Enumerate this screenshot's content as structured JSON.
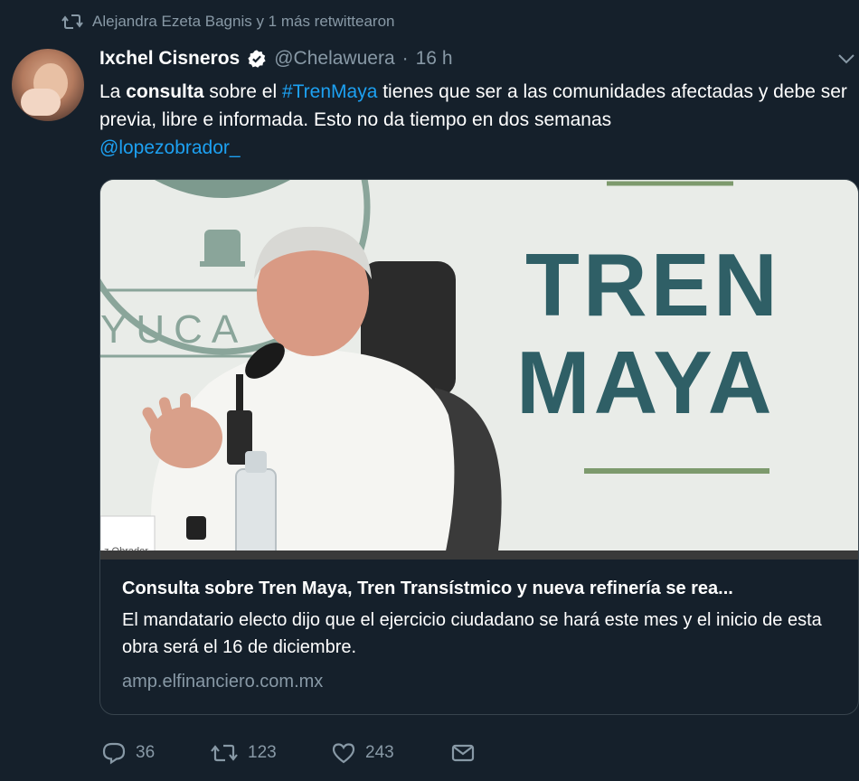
{
  "retweet_context": {
    "text": "Alejandra Ezeta Bagnis y 1 más retwittearon"
  },
  "author": {
    "name": "Ixchel Cisneros",
    "handle": "@Chelawuera",
    "separator": "·",
    "time": "16 h",
    "verified": true
  },
  "tweet": {
    "t1": "La ",
    "t2": "consulta",
    "t3": " sobre el ",
    "hashtag": "#TrenMaya",
    "t4": " tienes que ser a las comunidades afectadas y debe ser previa, libre e informada. Esto no da tiempo en dos semanas",
    "mention": "@lopezobrador_"
  },
  "card": {
    "image": {
      "sign_line1": "TREN",
      "sign_line2": "MAYA",
      "seal_text": "YUCA",
      "nameplate": "z Obrador",
      "colors": {
        "sign_text": "#2f5f66",
        "seal": "#8aa59a",
        "background": "#e9ece8"
      }
    },
    "title": "Consulta sobre Tren Maya, Tren Transístmico y nueva refinería se rea...",
    "description": "El mandatario electo dijo que el ejercicio ciudadano se hará este mes y el inicio de esta obra será el 16 de diciembre.",
    "domain": "amp.elfinanciero.com.mx"
  },
  "actions": {
    "reply_count": "36",
    "retweet_count": "123",
    "like_count": "243",
    "icons": [
      "reply-icon",
      "retweet-icon",
      "like-icon",
      "dm-icon"
    ]
  },
  "colors": {
    "background": "#15202b",
    "secondary_text": "#8899a6",
    "link": "#1da1f2",
    "verified_badge": "#ffffff",
    "border": "#38444d"
  }
}
